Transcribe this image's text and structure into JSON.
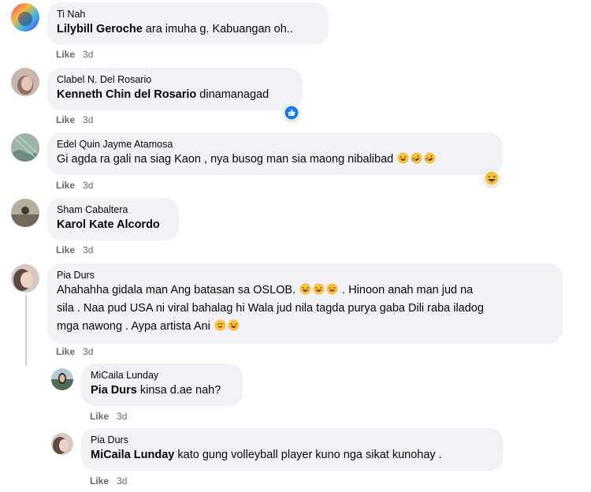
{
  "comments": [
    {
      "author": "Ti Nah",
      "mention": "Lilybill Geroche",
      "text": " ara imuha g. Kabuangan oh..",
      "like": "Like",
      "time": "3d"
    },
    {
      "author": "Clabel N. Del Rosario",
      "mention": "Kenneth Chin del Rosario",
      "text": " dinamanagad",
      "like": "Like",
      "time": "3d",
      "reaction": "like-reaction-icon"
    },
    {
      "author": "Edel Quin Jayme Atamosa",
      "mention": "",
      "text": "Gi agda ra gali na siag Kaon , nya busog man sia maong nibalibad",
      "like": "Like",
      "time": "3d",
      "reaction": "haha-reaction-icon"
    },
    {
      "author": "Sham Cabaltera",
      "mention": "Karol Kate Alcordo",
      "text": "",
      "like": "Like",
      "time": "3d"
    },
    {
      "author": "Pia Durs",
      "mention": "",
      "text_line1": "Ahahahha gidala man Ang batasan sa OSLOB.",
      "text_line1b": ". Hinoon anah man jud na",
      "text_line2": "sila . Naa pud USA ni viral bahalag hi Wala jud nila tagda purya gaba Dili raba iladog",
      "text_line3": "mga nawong . Aypa artista Ani",
      "like": "Like",
      "time": "3d"
    }
  ],
  "replies": [
    {
      "author": "MiCaila Lunday",
      "mention": "Pia Durs",
      "text": " kinsa d.ae nah?",
      "like": "Like",
      "time": "3d"
    },
    {
      "author": "Pia Durs",
      "mention": "MiCaila Lunday",
      "text": " kato gung volleyball player kuno nga sikat kunohay .",
      "like": "Like",
      "time": "3d"
    }
  ],
  "colors": {
    "bubble": "#f0f2f5",
    "meta": "#65676b",
    "text": "#050505",
    "like_blue": "#1877f2",
    "emoji_yellow": "#f7c23a"
  }
}
